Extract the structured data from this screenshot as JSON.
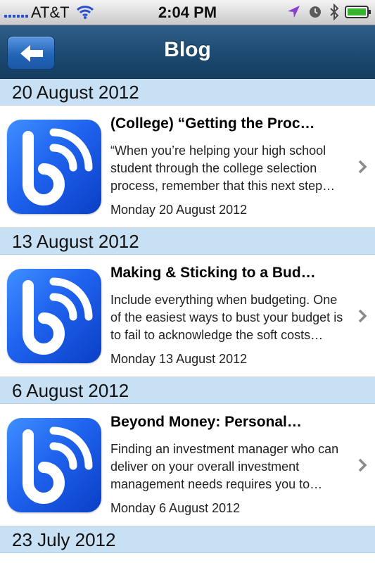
{
  "status_bar": {
    "carrier": "AT&T",
    "time": "2:04 PM",
    "icons": [
      "signal-icon",
      "wifi-icon",
      "location-icon",
      "alarm-icon",
      "bluetooth-icon",
      "battery-icon"
    ]
  },
  "nav": {
    "title": "Blog",
    "back_icon": "back-arrow-icon"
  },
  "colors": {
    "nav_bar": "#1d4a71",
    "section_header": "#c8e0f4",
    "thumb_blue": "#1f63ee"
  },
  "sections": [
    {
      "header": "20 August 2012",
      "item": {
        "title": "(College) “Getting the Proc…",
        "excerpt": "“When you’re helping your high school student through the college selection process, remember that this next step…",
        "date": "Monday 20 August 2012"
      }
    },
    {
      "header": "13 August 2012",
      "item": {
        "title": "Making & Sticking to a Bud…",
        "excerpt": "Include everything when budgeting. One of the easiest ways to bust your budget is to fail to acknowledge the soft costs…",
        "date": "Monday 13 August 2012"
      }
    },
    {
      "header": "6 August 2012",
      "item": {
        "title": "Beyond Money: Personal…",
        "excerpt": "Finding an investment manager who can deliver on your overall investment management needs requires you to…",
        "date": "Monday 6 August 2012"
      }
    },
    {
      "header": "23 July 2012"
    }
  ]
}
